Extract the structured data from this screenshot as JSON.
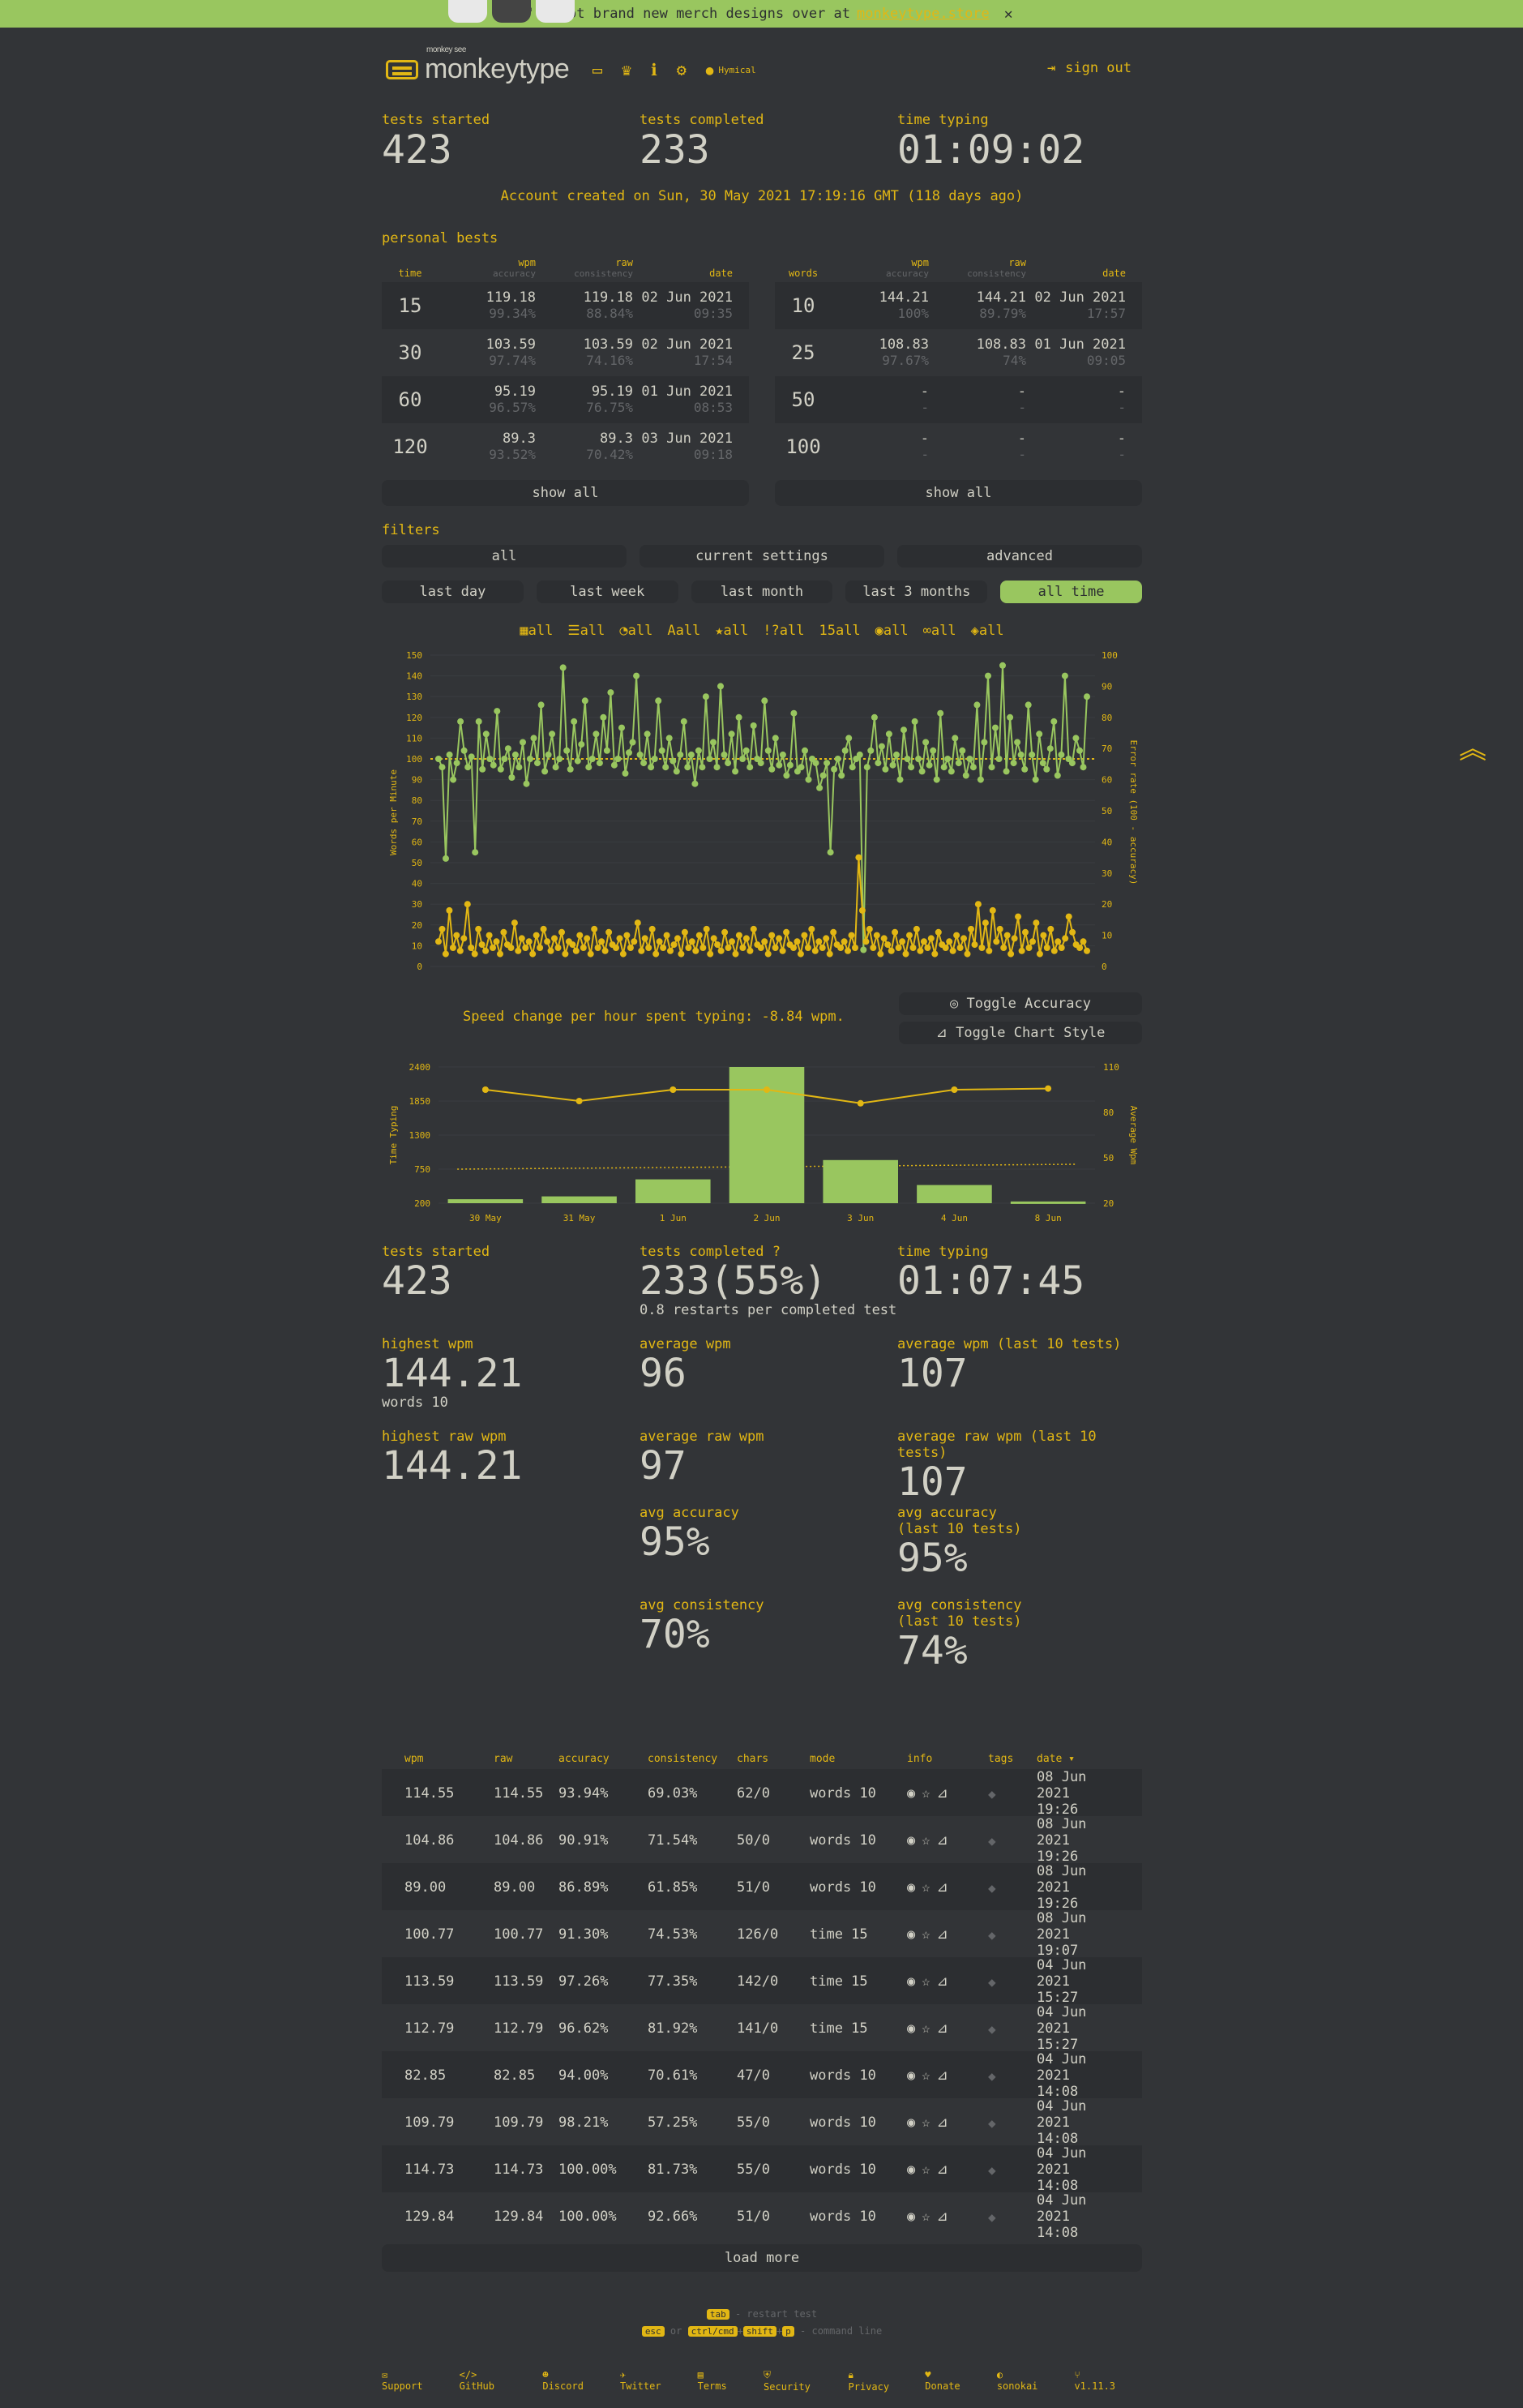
{
  "banner": {
    "text": "We've got brand new merch designs over at",
    "link": "monkeytype.store",
    "close": "✕"
  },
  "header": {
    "logo_top": "monkey see",
    "logo": "monkeytype",
    "username": "Hymical",
    "signout": "sign out"
  },
  "top_stats": {
    "started_label": "tests started",
    "started": "423",
    "completed_label": "tests completed",
    "completed": "233",
    "time_label": "time typing",
    "time": "01:09:02"
  },
  "created": "Account created on Sun, 30 May 2021 17:19:16 GMT (118 days ago)",
  "pb": {
    "title": "personal bests",
    "time_headers": [
      "time",
      "wpm",
      "accuracy",
      "raw",
      "consistency",
      "date"
    ],
    "word_headers": [
      "words",
      "wpm",
      "accuracy",
      "raw",
      "consistency",
      "date"
    ],
    "time_rows": [
      {
        "mode": "15",
        "wpm": "119.18",
        "acc": "99.34%",
        "raw": "119.18",
        "con": "88.84%",
        "date": "02 Jun 2021",
        "time": "09:35"
      },
      {
        "mode": "30",
        "wpm": "103.59",
        "acc": "97.74%",
        "raw": "103.59",
        "con": "74.16%",
        "date": "02 Jun 2021",
        "time": "17:54"
      },
      {
        "mode": "60",
        "wpm": "95.19",
        "acc": "96.57%",
        "raw": "95.19",
        "con": "76.75%",
        "date": "01 Jun 2021",
        "time": "08:53"
      },
      {
        "mode": "120",
        "wpm": "89.3",
        "acc": "93.52%",
        "raw": "89.3",
        "con": "70.42%",
        "date": "03 Jun 2021",
        "time": "09:18"
      }
    ],
    "word_rows": [
      {
        "mode": "10",
        "wpm": "144.21",
        "acc": "100%",
        "raw": "144.21",
        "con": "89.79%",
        "date": "02 Jun 2021",
        "time": "17:57"
      },
      {
        "mode": "25",
        "wpm": "108.83",
        "acc": "97.67%",
        "raw": "108.83",
        "con": "74%",
        "date": "01 Jun 2021",
        "time": "09:05"
      },
      {
        "mode": "50",
        "wpm": "-",
        "acc": "-",
        "raw": "-",
        "con": "-",
        "date": "-",
        "time": "-"
      },
      {
        "mode": "100",
        "wpm": "-",
        "acc": "-",
        "raw": "-",
        "con": "-",
        "date": "-",
        "time": "-"
      }
    ],
    "show_all": "show all"
  },
  "filters": {
    "title": "filters",
    "presets": [
      "all",
      "current settings",
      "advanced"
    ],
    "ranges": [
      "last day",
      "last week",
      "last month",
      "last 3 months",
      "all time"
    ],
    "active_range": "all time",
    "chips": [
      {
        "icon": "calendar-icon",
        "glyph": "▦",
        "label": "all"
      },
      {
        "icon": "list-icon",
        "glyph": "☰",
        "label": "all"
      },
      {
        "icon": "clock-icon",
        "glyph": "◔",
        "label": "all"
      },
      {
        "icon": "font-icon",
        "glyph": "A",
        "label": "all"
      },
      {
        "icon": "star-icon",
        "glyph": "★",
        "label": "all"
      },
      {
        "icon": "punctuation-icon",
        "glyph": "!?",
        "label": "all"
      },
      {
        "icon": "numbers-icon",
        "glyph": "15",
        "label": "all"
      },
      {
        "icon": "globe-icon",
        "glyph": "◉",
        "label": "all"
      },
      {
        "icon": "glasses-icon",
        "glyph": "∞",
        "label": "all"
      },
      {
        "icon": "tag-icon",
        "glyph": "◈",
        "label": "all"
      }
    ]
  },
  "chart_data": [
    {
      "type": "line",
      "ylabel": "Words per Minute",
      "y2label": "Error rate (100 - accuracy)",
      "ylim": [
        0,
        150
      ],
      "y2lim": [
        0,
        100
      ],
      "yticks": [
        "150",
        "140",
        "130",
        "120",
        "110",
        "100",
        "90",
        "80",
        "70",
        "60",
        "50",
        "40",
        "30",
        "20",
        "10",
        "0"
      ],
      "y2ticks": [
        "100",
        "90",
        "80",
        "70",
        "60",
        "50",
        "40",
        "30",
        "20",
        "10",
        "0"
      ],
      "series": [
        {
          "color": "#99c65f",
          "values": [
            100,
            96,
            52,
            102,
            90,
            98,
            118,
            104,
            96,
            101,
            55,
            118,
            95,
            112,
            100,
            97,
            123,
            95,
            100,
            105,
            91,
            102,
            96,
            108,
            88,
            100,
            110,
            98,
            126,
            94,
            102,
            112,
            96,
            100,
            144,
            104,
            95,
            118,
            99,
            107,
            128,
            96,
            100,
            112,
            98,
            120,
            104,
            132,
            97,
            100,
            115,
            93,
            103,
            108,
            140,
            102,
            98,
            112,
            96,
            100,
            128,
            104,
            96,
            110,
            99,
            94,
            102,
            118,
            96,
            102,
            88,
            104,
            96,
            130,
            100,
            108,
            96,
            135,
            102,
            98,
            112,
            94,
            120,
            100,
            104,
            96,
            116,
            100,
            98,
            128,
            104,
            95,
            110,
            97,
            102,
            92,
            97,
            122,
            94,
            96,
            104,
            90,
            100,
            98,
            86,
            92,
            98,
            55,
            95,
            100,
            92,
            104,
            110,
            96,
            100,
            102,
            8,
            96,
            104,
            120,
            98,
            106,
            95,
            112,
            97,
            102,
            90,
            114,
            100,
            96,
            118,
            100,
            94,
            108,
            97,
            104,
            90,
            122,
            96,
            100,
            94,
            110,
            98,
            104,
            92,
            100,
            96,
            126,
            90,
            108,
            140,
            96,
            115,
            100,
            145,
            94,
            120,
            98,
            108,
            102,
            95,
            126,
            102,
            90,
            112,
            98,
            95,
            105,
            118,
            92,
            102,
            140,
            100,
            98,
            110,
            104,
            96,
            130
          ]
        },
        {
          "color": "#e2b714",
          "values": [
            8,
            12,
            4,
            18,
            6,
            10,
            5,
            9,
            20,
            6,
            4,
            12,
            7,
            5,
            10,
            6,
            8,
            4,
            11,
            7,
            6,
            14,
            5,
            9,
            6,
            8,
            4,
            10,
            6,
            12,
            8,
            5,
            9,
            6,
            11,
            4,
            8,
            7,
            5,
            10,
            6,
            9,
            4,
            12,
            6,
            8,
            5,
            11,
            7,
            6,
            9,
            4,
            10,
            6,
            8,
            14,
            5,
            9,
            6,
            12,
            4,
            8,
            6,
            10,
            5,
            7,
            9,
            4,
            11,
            6,
            8,
            5,
            10,
            6,
            12,
            4,
            9,
            7,
            5,
            11,
            6,
            8,
            4,
            10,
            6,
            9,
            5,
            12,
            7,
            6,
            8,
            4,
            10,
            6,
            9,
            5,
            11,
            7,
            6,
            8,
            4,
            10,
            6,
            12,
            5,
            8,
            6,
            9,
            4,
            11,
            7,
            6,
            8,
            5,
            10,
            6,
            35,
            18,
            8,
            12,
            6,
            10,
            4,
            9,
            7,
            5,
            11,
            6,
            8,
            4,
            10,
            6,
            12,
            5,
            8,
            6,
            9,
            4,
            11,
            7,
            6,
            8,
            5,
            10,
            6,
            9,
            4,
            12,
            7,
            20,
            6,
            14,
            5,
            18,
            8,
            12,
            6,
            10,
            4,
            9,
            16,
            5,
            11,
            6,
            8,
            14,
            4,
            10,
            6,
            12,
            5,
            8,
            6,
            9,
            16,
            11,
            7,
            6,
            8,
            5
          ]
        }
      ],
      "avg_line": 100
    },
    {
      "type": "bar",
      "ylabel": "Time Typing",
      "y2label": "Average Wpm",
      "categories": [
        "30 May",
        "31 May",
        "1 Jun",
        "2 Jun",
        "3 Jun",
        "4 Jun",
        "8 Jun"
      ],
      "yticks": [
        "2400",
        "1850",
        "1300",
        "750",
        "200"
      ],
      "y2ticks": [
        "110",
        "80",
        "50",
        "20"
      ],
      "ylim": [
        0,
        2400
      ],
      "y2lim": [
        0,
        120
      ],
      "values": [
        70,
        120,
        420,
        2400,
        760,
        320,
        30
      ],
      "line_values": [
        100,
        90,
        100,
        100,
        88,
        100,
        101
      ]
    }
  ],
  "chart_buttons": {
    "toggle_accuracy": "Toggle Accuracy",
    "toggle_style": "Toggle Chart Style"
  },
  "speed_change": "Speed change per hour spent typing: -8.84 wpm.",
  "stats": {
    "started_label": "tests started",
    "started": "423",
    "completed_label": "tests completed",
    "completed": "233(55%)",
    "restarts": "0.8 restarts per completed test",
    "time_label": "time typing",
    "time": "01:07:45",
    "highest_wpm_label": "highest wpm",
    "highest_wpm": "144.21",
    "highest_wpm_mode": "words 10",
    "avg_wpm_label": "average wpm",
    "avg_wpm": "96",
    "avg_wpm10_label": "average wpm (last 10 tests)",
    "avg_wpm10": "107",
    "highest_raw_label": "highest raw wpm",
    "highest_raw": "144.21",
    "avg_raw_label": "average raw wpm",
    "avg_raw": "97",
    "avg_raw10_label": "average raw wpm (last 10 tests)",
    "avg_raw10": "107",
    "avg_acc_label": "avg accuracy",
    "avg_acc": "95%",
    "avg_acc10_label": "avg accuracy",
    "avg_acc10_sub": "(last 10 tests)",
    "avg_acc10": "95%",
    "avg_con_label": "avg consistency",
    "avg_con": "70%",
    "avg_con10_label": "avg consistency",
    "avg_con10_sub": "(last 10 tests)",
    "avg_con10": "74%"
  },
  "history": {
    "headers": [
      "wpm",
      "raw",
      "accuracy",
      "consistency",
      "chars",
      "mode",
      "info",
      "tags",
      "date ▾"
    ],
    "rows": [
      {
        "wpm": "114.55",
        "raw": "114.55",
        "acc": "93.94%",
        "con": "69.03%",
        "chars": "62/0",
        "mode": "words 10",
        "date": "08 Jun 2021",
        "time": "19:26"
      },
      {
        "wpm": "104.86",
        "raw": "104.86",
        "acc": "90.91%",
        "con": "71.54%",
        "chars": "50/0",
        "mode": "words 10",
        "date": "08 Jun 2021",
        "time": "19:26"
      },
      {
        "wpm": "89.00",
        "raw": "89.00",
        "acc": "86.89%",
        "con": "61.85%",
        "chars": "51/0",
        "mode": "words 10",
        "date": "08 Jun 2021",
        "time": "19:26"
      },
      {
        "wpm": "100.77",
        "raw": "100.77",
        "acc": "91.30%",
        "con": "74.53%",
        "chars": "126/0",
        "mode": "time 15",
        "date": "08 Jun 2021",
        "time": "19:07"
      },
      {
        "wpm": "113.59",
        "raw": "113.59",
        "acc": "97.26%",
        "con": "77.35%",
        "chars": "142/0",
        "mode": "time 15",
        "date": "04 Jun 2021",
        "time": "15:27"
      },
      {
        "wpm": "112.79",
        "raw": "112.79",
        "acc": "96.62%",
        "con": "81.92%",
        "chars": "141/0",
        "mode": "time 15",
        "date": "04 Jun 2021",
        "time": "15:27"
      },
      {
        "wpm": "82.85",
        "raw": "82.85",
        "acc": "94.00%",
        "con": "70.61%",
        "chars": "47/0",
        "mode": "words 10",
        "date": "04 Jun 2021",
        "time": "14:08"
      },
      {
        "wpm": "109.79",
        "raw": "109.79",
        "acc": "98.21%",
        "con": "57.25%",
        "chars": "55/0",
        "mode": "words 10",
        "date": "04 Jun 2021",
        "time": "14:08"
      },
      {
        "wpm": "114.73",
        "raw": "114.73",
        "acc": "100.00%",
        "con": "81.73%",
        "chars": "55/0",
        "mode": "words 10",
        "date": "04 Jun 2021",
        "time": "14:08"
      },
      {
        "wpm": "129.84",
        "raw": "129.84",
        "acc": "100.00%",
        "con": "92.66%",
        "chars": "51/0",
        "mode": "words 10",
        "date": "04 Jun 2021",
        "time": "14:08"
      }
    ],
    "load_more": "load more"
  },
  "footer": {
    "tab_key": "tab",
    "restart": " - restart test",
    "esc": "esc",
    "or": " or ",
    "ctrl": "ctrl/cmd",
    "plus": "+",
    "shift": "shift",
    "p": "p",
    "cmdline": " - command line",
    "links": [
      "Support",
      "GitHub",
      "Discord",
      "Twitter",
      "Terms",
      "Security",
      "Privacy",
      "Donate"
    ],
    "theme": "sonokai",
    "version": "v1.11.3"
  }
}
